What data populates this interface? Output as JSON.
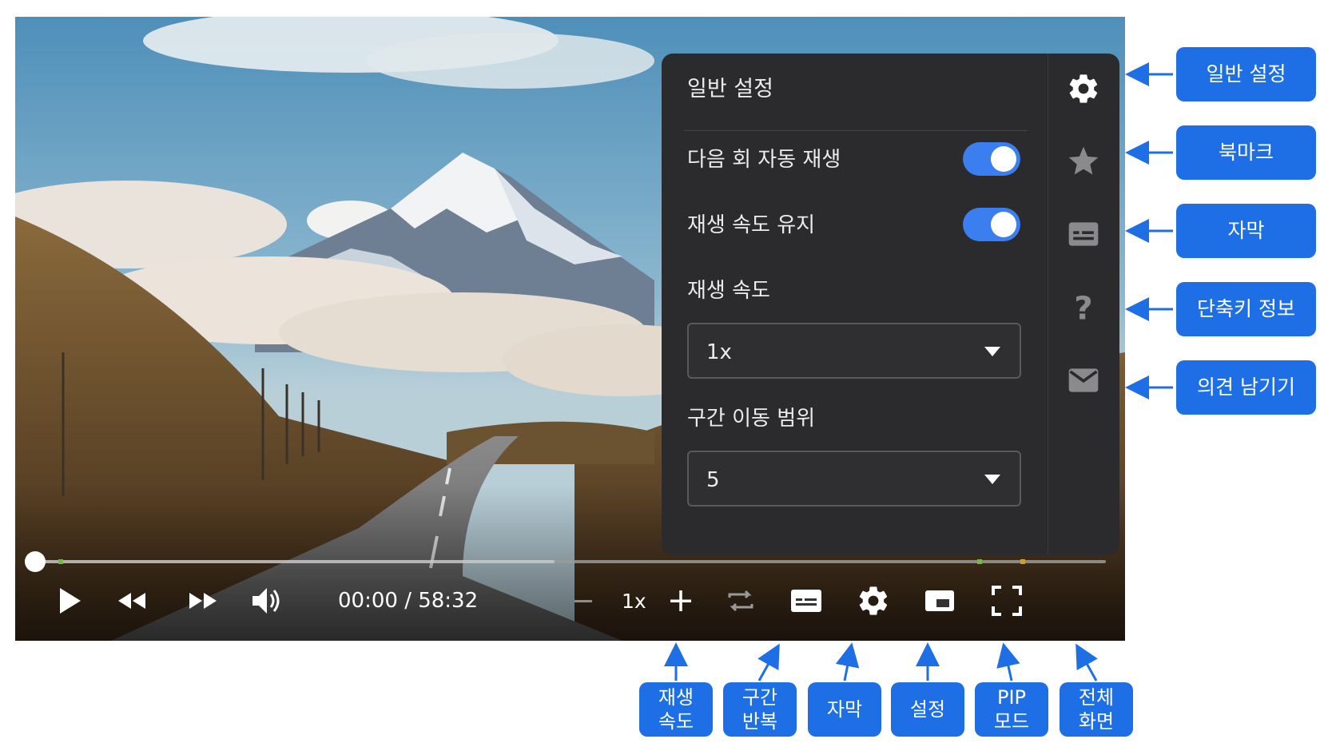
{
  "panel": {
    "title": "일반 설정",
    "autoplay_label": "다음 회 자동 재생",
    "autoplay_on": true,
    "keep_speed_label": "재생 속도 유지",
    "keep_speed_on": true,
    "speed_label": "재생 속도",
    "speed_value": "1x",
    "seek_label": "구간 이동 범위",
    "seek_value": "5"
  },
  "side_icons": [
    "gear-icon",
    "star-icon",
    "subtitle-icon",
    "question-icon",
    "mail-icon"
  ],
  "controls": {
    "time": "00:00 / 58:32",
    "speed": "1x"
  },
  "progress": {
    "played_fraction": 0.0,
    "buffered_fraction": 0.485
  },
  "callouts_right": [
    "일반 설정",
    "북마크",
    "자막",
    "단축키 정보",
    "의견 남기기"
  ],
  "callouts_bottom": [
    [
      "재생",
      "속도"
    ],
    [
      "구간",
      "반복"
    ],
    [
      "자막"
    ],
    [
      "설정"
    ],
    [
      "PIP",
      "모드"
    ],
    [
      "전체",
      "화면"
    ]
  ],
  "colors": {
    "accent": "#3b7ef0",
    "callout": "#1e6fe6",
    "panel_bg": "#2b2b2d"
  }
}
